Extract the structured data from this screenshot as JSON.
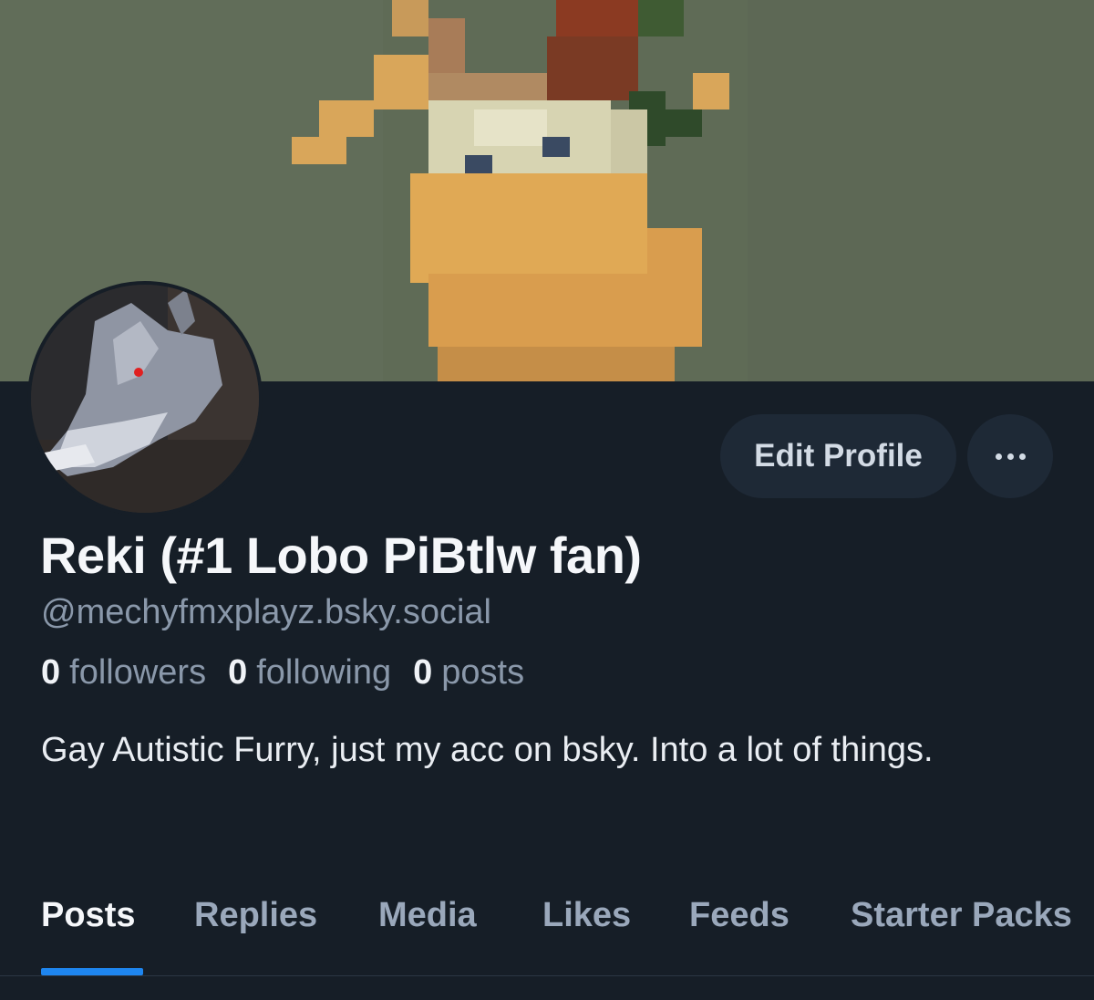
{
  "profile": {
    "display_name": "Reki (#1 Lobo PiBtlw fan)",
    "handle": "@mechyfmxplayz.bsky.social",
    "bio": "Gay Autistic Furry, just my acc on bsky. Into a lot of things."
  },
  "stats": {
    "followers": {
      "count": "0",
      "label": "followers"
    },
    "following": {
      "count": "0",
      "label": "following"
    },
    "posts": {
      "count": "0",
      "label": "posts"
    }
  },
  "actions": {
    "edit_profile": "Edit Profile",
    "more_icon": "ellipsis-icon"
  },
  "tabs": [
    {
      "label": "Posts",
      "active": true
    },
    {
      "label": "Replies",
      "active": false
    },
    {
      "label": "Media",
      "active": false
    },
    {
      "label": "Likes",
      "active": false
    },
    {
      "label": "Feeds",
      "active": false
    },
    {
      "label": "Starter Packs",
      "active": false
    }
  ],
  "colors": {
    "background": "#161e27",
    "accent": "#1e86f0",
    "button_bg": "#1e2936",
    "secondary_text": "#8a98aa"
  }
}
